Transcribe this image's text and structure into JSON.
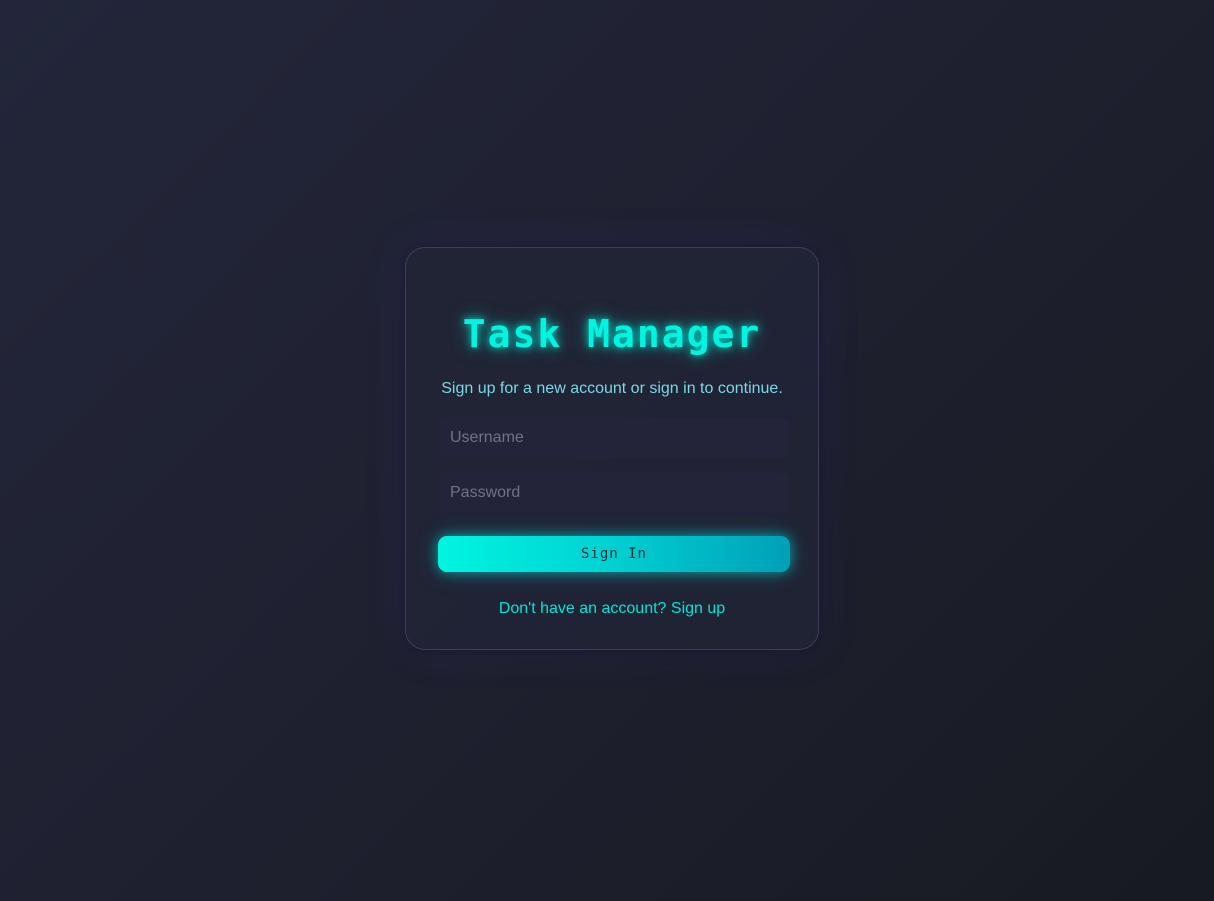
{
  "app": {
    "title": "Task Manager",
    "subtitle": "Sign up for a new account or sign in to continue."
  },
  "form": {
    "username_placeholder": "Username",
    "username_value": "",
    "password_placeholder": "Password",
    "password_value": "",
    "submit_label": "Sign In",
    "signup_link_label": "Don't have an account? Sign up"
  },
  "colors": {
    "accent": "#00f5e0",
    "background": "#1f2131",
    "card": "#212436",
    "field": "#23233a"
  }
}
